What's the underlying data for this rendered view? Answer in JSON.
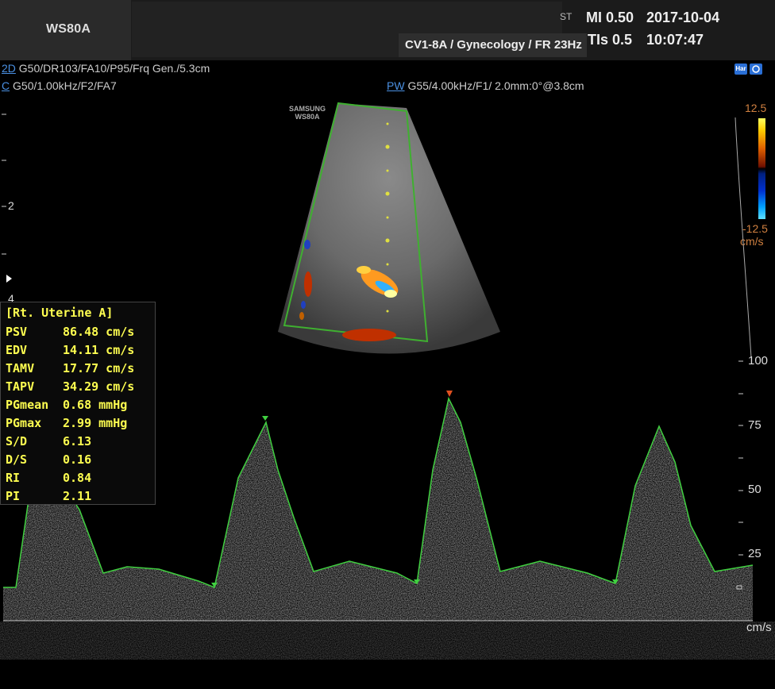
{
  "header": {
    "model": "WS80A",
    "probe": "CV1-8A / Gynecology / FR 23Hz",
    "st": "ST",
    "mi": "MI  0.50",
    "tis": "TIs 0.5",
    "date": "2017-10-04",
    "time": "10:07:47"
  },
  "params": {
    "mode2d": "2D",
    "mode2d_params": " G50/DR103/FA10/P95/Frq Gen./5.3cm",
    "modec": "C",
    "modec_params": " G50/1.00kHz/F2/FA7",
    "modepw": "PW",
    "modepw_params": " G55/4.00kHz/F1/ 2.0mm:0°@3.8cm"
  },
  "icons": {
    "har": "Har",
    "camera": "camera-icon"
  },
  "colorbar": {
    "max": "12.5",
    "min": "-12.5",
    "unit": "cm/s"
  },
  "logo": {
    "line1": "SAMSUNG",
    "line2": "WS80A"
  },
  "left_scale": {
    "two": "2",
    "four": "4"
  },
  "measurements": {
    "title": "[Rt. Uterine A]",
    "rows": [
      {
        "name": "PSV",
        "value": "86.48 cm/s"
      },
      {
        "name": "EDV",
        "value": "14.11 cm/s"
      },
      {
        "name": "TAMV",
        "value": "17.77 cm/s"
      },
      {
        "name": "TAPV",
        "value": "34.29 cm/s"
      },
      {
        "name": "PGmean",
        "value": "0.68 mmHg"
      },
      {
        "name": "PGmax",
        "value": "2.99 mmHg"
      },
      {
        "name": "S/D",
        "value": "6.13"
      },
      {
        "name": "D/S",
        "value": "0.16"
      },
      {
        "name": "RI",
        "value": "0.84"
      },
      {
        "name": "PI",
        "value": "2.11"
      }
    ]
  },
  "velocity_scale": {
    "t100": "100",
    "t75": "75",
    "t50": "50",
    "t25": "25",
    "unit": "cm/s"
  }
}
